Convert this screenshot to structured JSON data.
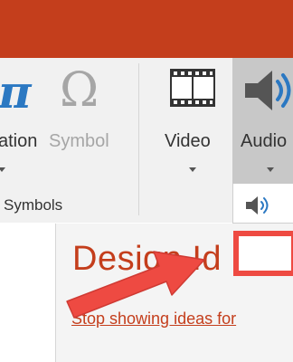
{
  "ribbon": {
    "equation_label": "ation",
    "symbol_label": "Symbol",
    "video_label": "Video",
    "audio_label": "Audio",
    "symbols_group_label": "Symbols",
    "pi_glyph": "π",
    "omega_glyph": "Ω"
  },
  "audio_menu": {
    "icon": "speaker-icon"
  },
  "design_pane": {
    "title": "Design Id",
    "stop_link": "Stop showing ideas for"
  },
  "colors": {
    "brand": "#c43e1c",
    "ribbon_bg": "#f1f1f1",
    "annotation": "#ee4a42",
    "equation_blue": "#2b78c2"
  }
}
